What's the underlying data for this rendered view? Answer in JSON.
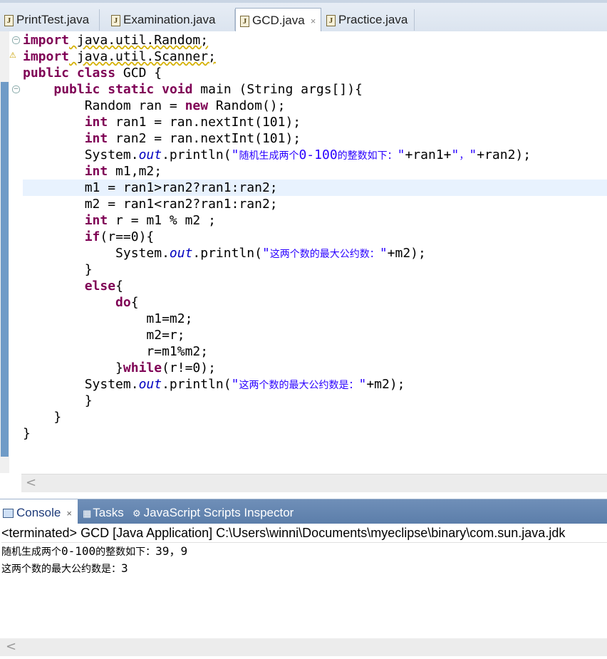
{
  "editor_tabs": [
    {
      "label": "PrintTest.java"
    },
    {
      "label": "Examination.java"
    },
    {
      "label": "GCD.java",
      "active": true,
      "close": "×"
    },
    {
      "label": "Practice.java"
    }
  ],
  "file_icon": "java-file-icon",
  "code": {
    "lines": [
      [
        "import",
        " java.util.Random;"
      ],
      [
        "import",
        " java.util.Scanner;"
      ],
      [
        "public",
        " ",
        "class",
        " GCD {"
      ],
      [
        "    ",
        "public",
        " ",
        "static",
        " ",
        "void",
        " main (String args[]){"
      ],
      [
        "        Random ran = ",
        "new",
        " Random();"
      ],
      [
        "        ",
        "int",
        " ran1 = ran.nextInt(101);"
      ],
      [
        "        ",
        "int",
        " ran2 = ran.nextInt(101);"
      ],
      [
        "        System.",
        "out",
        ".println(",
        "\"",
        "随机生成两个",
        "0-100",
        "的整数如下：",
        "\"",
        "+ran1+",
        "\"",
        "，",
        "\"",
        "+ran2);"
      ],
      [
        "        ",
        "int",
        " m1,m2;"
      ],
      [
        "        m1 = ran1>ran2?ran1:ran2;"
      ],
      [
        "        m2 = ran1<ran2?ran1:ran2;"
      ],
      [
        "        ",
        "int",
        " r = m1 % m2 ;"
      ],
      [
        "        ",
        "if",
        "(r==0){"
      ],
      [
        "            System.",
        "out",
        ".println(",
        "\"",
        "这两个数的最大公约数：",
        "\"",
        "+m2);"
      ],
      [
        "        }"
      ],
      [
        "        ",
        "else",
        "{"
      ],
      [
        "            ",
        "do",
        "{"
      ],
      [
        "                m1=m2;"
      ],
      [
        "                m2=r;"
      ],
      [
        "                r=m1%m2;"
      ],
      [
        "            }",
        "while",
        "(r!=0);"
      ],
      [
        "        System.",
        "out",
        ".println(",
        "\"",
        "这两个数的最大公约数是：",
        "\"",
        "+m2);"
      ],
      [
        "        }"
      ],
      [
        "    }"
      ],
      [
        "}"
      ]
    ]
  },
  "console_tabs": [
    {
      "label": "Console",
      "active": true,
      "close": "×",
      "icon": "console-icon"
    },
    {
      "label": "Tasks",
      "icon": "tasks-icon"
    },
    {
      "label": "JavaScript Scripts Inspector",
      "icon": "javascript-icon"
    }
  ],
  "console": {
    "header": "<terminated> GCD [Java Application] C:\\Users\\winni\\Documents\\myeclipse\\binary\\com.sun.java.jdk",
    "output": [
      [
        "随机生成两个",
        "0-100",
        "的整数如下：",
        "39，9"
      ],
      [
        "这两个数的最大公约数是：",
        "3"
      ]
    ]
  },
  "scroll_arrow": "<"
}
